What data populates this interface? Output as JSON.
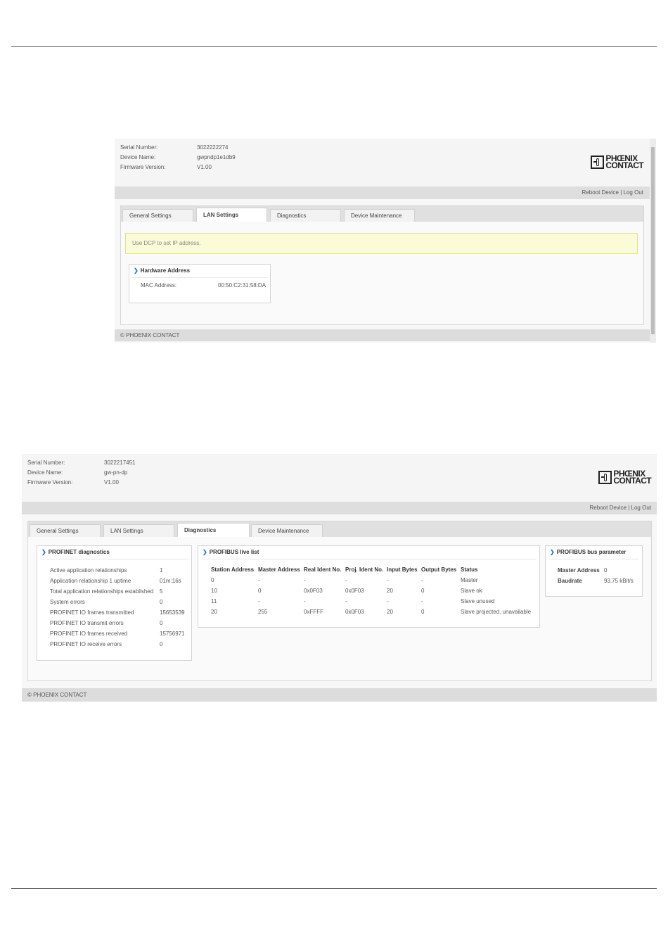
{
  "brand": {
    "line1": "PHŒNIX",
    "line2": "CONTACT"
  },
  "info_labels": {
    "serial": "Serial Number:",
    "device": "Device Name:",
    "firmware": "Firmware Version:"
  },
  "links": {
    "reboot": "Reboot Device",
    "sep": " | ",
    "logout": "Log Out"
  },
  "tabs": [
    "General Settings",
    "LAN Settings",
    "Diagnostics",
    "Device Maintenance"
  ],
  "footer": "© PHOENIX CONTACT",
  "screen1": {
    "serial": "3022222274",
    "device": "gwpndp1e1db9",
    "firmware": "V1.00",
    "active_tab": "LAN Settings",
    "notice": "Use DCP to set IP address.",
    "hw_card": {
      "title": "Hardware Address",
      "mac_label": "MAC Address:",
      "mac_value": "00:50:C2:31:58:DA"
    }
  },
  "screen2": {
    "serial": "3022217451",
    "device": "gw-pn-dp",
    "firmware": "V1.00",
    "active_tab": "Diagnostics",
    "profinet": {
      "title": "PROFINET diagnostics",
      "rows": [
        [
          "Active application relationships",
          "1"
        ],
        [
          "Application relationship 1 uptime",
          "01m:16s"
        ],
        [
          "Total application relationships established",
          "5"
        ],
        [
          "System errors",
          "0"
        ],
        [
          "PROFINET IO frames transmitted",
          "15653539"
        ],
        [
          "PROFINET IO transmit errors",
          "0"
        ],
        [
          "PROFINET IO frames received",
          "15756971"
        ],
        [
          "PROFINET IO receive errors",
          "0"
        ]
      ]
    },
    "livelist": {
      "title": "PROFIBUS live list",
      "headers": [
        "Station Address",
        "Master Address",
        "Real Ident No.",
        "Proj. Ident No.",
        "Input Bytes",
        "Output Bytes",
        "Status"
      ],
      "rows": [
        [
          "0",
          "-",
          "-",
          "-",
          "-",
          "-",
          "Master"
        ],
        [
          "10",
          "0",
          "0x0F03",
          "0x0F03",
          "20",
          "0",
          "Slave ok"
        ],
        [
          "11",
          "-",
          "-",
          "-",
          "-",
          "-",
          "Slave unused"
        ],
        [
          "20",
          "255",
          "0xFFFF",
          "0x0F03",
          "20",
          "0",
          "Slave projected, unavailable"
        ]
      ]
    },
    "busparam": {
      "title": "PROFIBUS bus parameter",
      "rows": [
        [
          "Master Address",
          "0"
        ],
        [
          "Baudrate",
          "93.75 kBit/s"
        ]
      ]
    }
  }
}
